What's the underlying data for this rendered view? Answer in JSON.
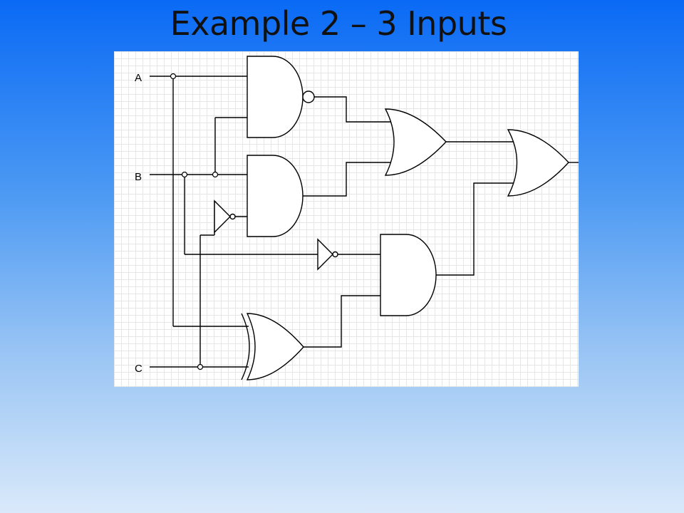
{
  "slide": {
    "title": "Example 2 – 3 Inputs"
  },
  "diagram": {
    "inputs": [
      {
        "id": "A",
        "label": "A"
      },
      {
        "id": "B",
        "label": "B"
      },
      {
        "id": "C",
        "label": "C"
      }
    ],
    "gates": [
      {
        "id": "g1",
        "type": "NAND",
        "inputs": [
          "A",
          "B"
        ]
      },
      {
        "id": "g2",
        "type": "AND",
        "inputs": [
          "B",
          "NOT C"
        ]
      },
      {
        "id": "g3",
        "type": "NOT",
        "inputs": [
          "C"
        ]
      },
      {
        "id": "g4",
        "type": "OR",
        "inputs": [
          "g1",
          "g2"
        ]
      },
      {
        "id": "g5",
        "type": "NOT",
        "inputs": [
          "B"
        ]
      },
      {
        "id": "g6",
        "type": "XOR",
        "inputs": [
          "A",
          "C"
        ]
      },
      {
        "id": "g7",
        "type": "AND",
        "inputs": [
          "NOT B",
          "g6"
        ]
      },
      {
        "id": "g8",
        "type": "OR",
        "inputs": [
          "g4",
          "g7"
        ]
      }
    ]
  }
}
